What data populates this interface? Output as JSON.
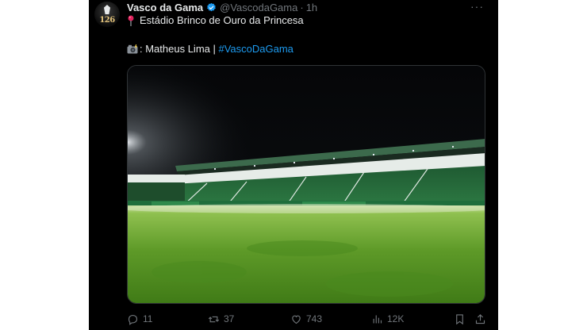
{
  "author": {
    "display_name": "Vasco da Gama",
    "handle": "@VascodaGama",
    "separator": "·",
    "time": "1h",
    "avatar_badge": "126"
  },
  "tweet": {
    "line1_text": "Estádio Brinco de Ouro da Princesa",
    "credit_text": ": Matheus Lima | ",
    "hashtag": "#VascoDaGama"
  },
  "icons": {
    "verified": "verified-badge-icon",
    "pin": "round-pushpin-icon",
    "camera": "camera-flash-icon",
    "more": "more-icon",
    "reply": "reply-icon",
    "retweet": "retweet-icon",
    "like": "like-icon",
    "views": "views-icon",
    "bookmark": "bookmark-icon",
    "share": "share-icon"
  },
  "actions": {
    "replies": "11",
    "retweets": "37",
    "likes": "743",
    "views": "12K"
  },
  "colors": {
    "background": "#000000",
    "text": "#e7e9ea",
    "muted": "#71767b",
    "link": "#1d9bf0",
    "verified": "#1d9bf0"
  },
  "more_label": "···"
}
